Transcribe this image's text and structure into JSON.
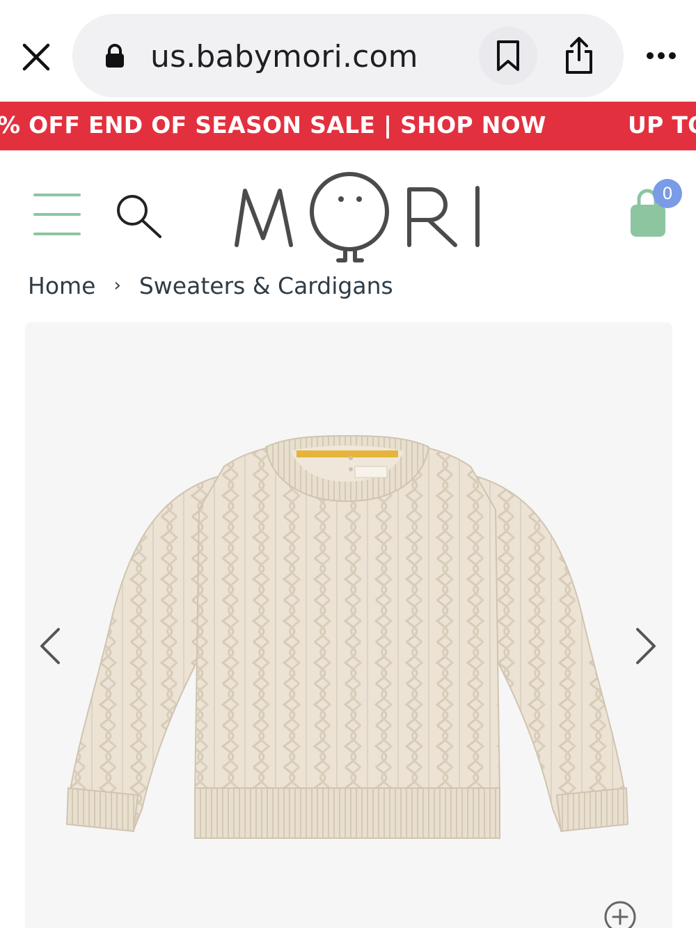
{
  "browser": {
    "url": "us.babymori.com",
    "icons": [
      "close-icon",
      "lock-icon",
      "bookmark-icon",
      "share-icon",
      "more-icon"
    ]
  },
  "promo": {
    "text_left": "% OFF END OF SEASON SALE | SHOP NOW",
    "text_right": "UP TO",
    "background": "#e3303f"
  },
  "header": {
    "logo_text": "MORI",
    "cart_count": "0",
    "accent": "#8cc5a0",
    "badge_color": "#7a9be6",
    "icons": [
      "menu-icon",
      "search-icon",
      "shopping-bag-icon"
    ]
  },
  "breadcrumb": {
    "items": [
      "Home",
      "Sweaters & Cardigans"
    ],
    "separator": "›"
  },
  "gallery": {
    "product_image": "cream cable-knit sweater",
    "icons": [
      "chevron-left-icon",
      "chevron-right-icon",
      "zoom-in-icon"
    ]
  }
}
